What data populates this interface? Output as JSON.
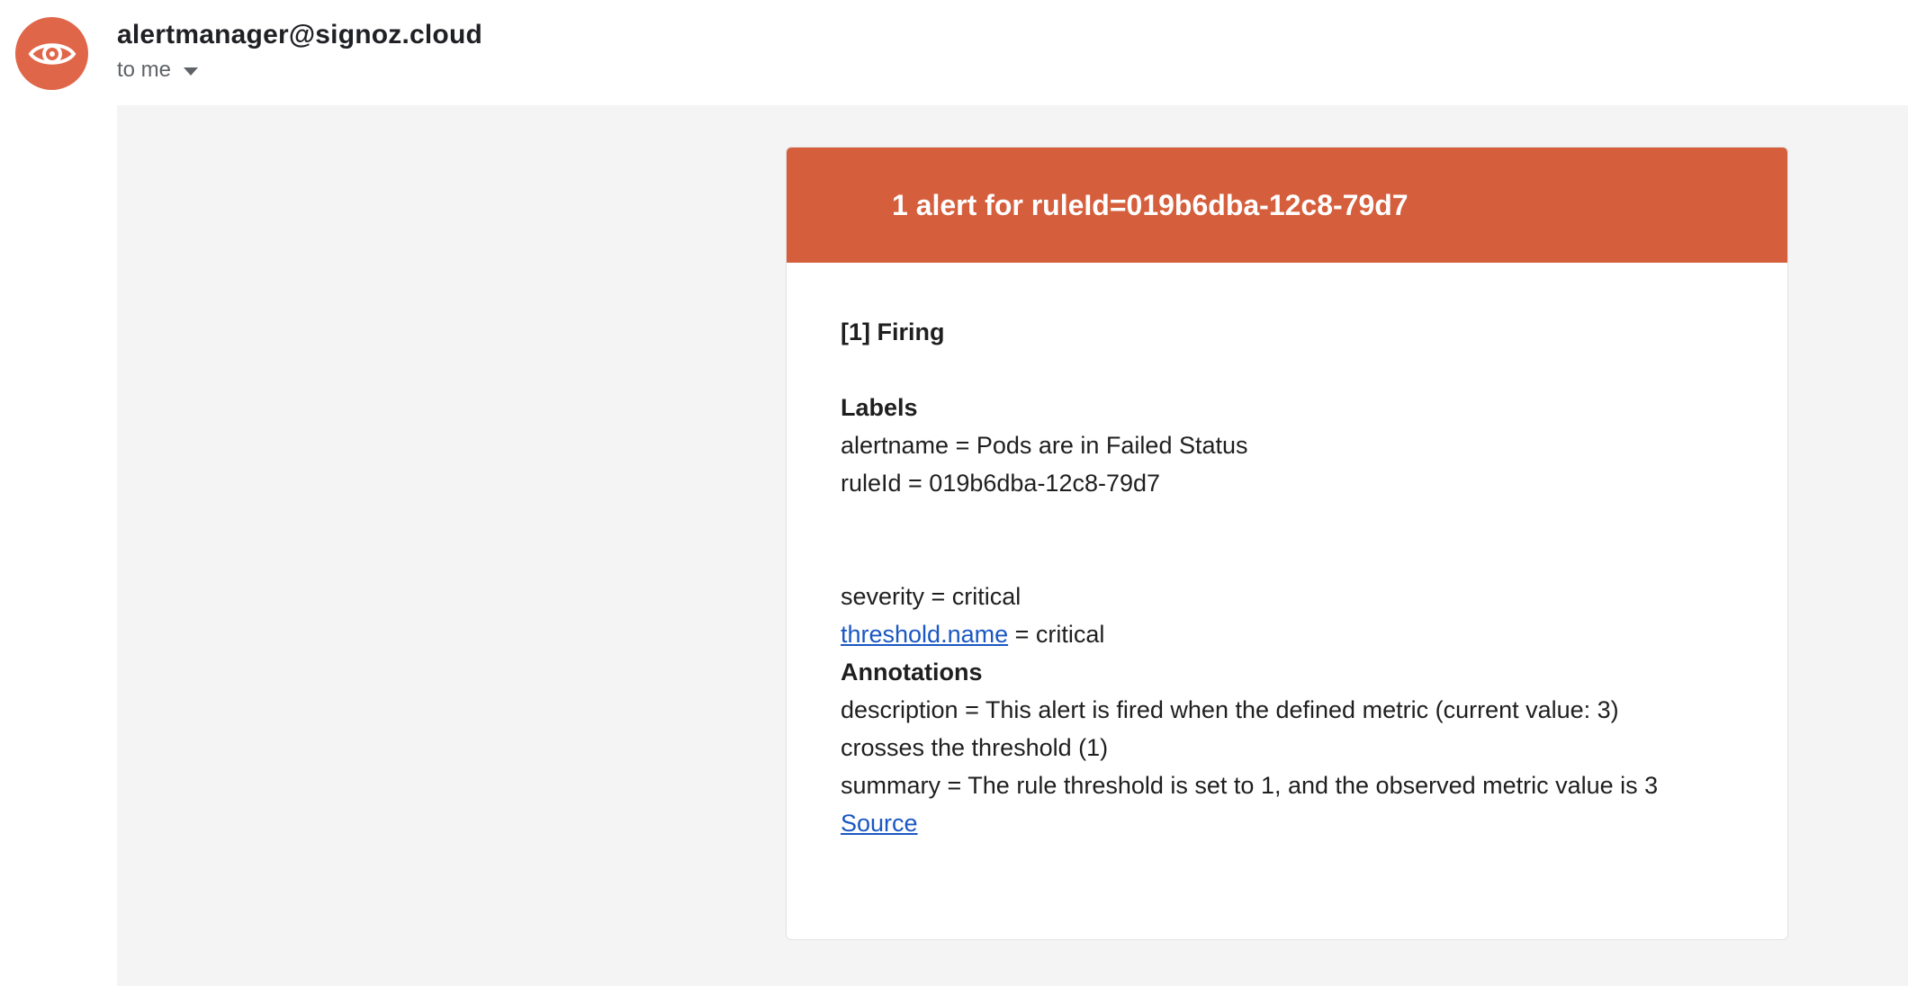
{
  "header": {
    "sender": "alertmanager@signoz.cloud",
    "recipient": "to me",
    "avatar_icon": "eye-icon",
    "avatar_color": "#e0664a"
  },
  "alert_card": {
    "title": "1 alert for ruleId=019b6dba-12c8-79d7",
    "header_color": "#d55e3c",
    "status": "[1] Firing",
    "labels_heading": "Labels",
    "labels": {
      "alertname": "alertname = Pods are in Failed Status",
      "ruleid": "ruleId = 019b6dba-12c8-79d7",
      "severity": "severity = critical",
      "threshold_key": "threshold.name",
      "threshold_value": " = critical"
    },
    "annotations_heading": "Annotations",
    "annotations": {
      "description_line1": "description = This alert is fired when the defined metric (current value: 3)",
      "description_line2": "crosses the threshold (1)",
      "summary": "summary = The rule threshold is set to 1, and the observed metric value is 3"
    },
    "source_link": "Source",
    "link_color": "#1a57c2"
  }
}
